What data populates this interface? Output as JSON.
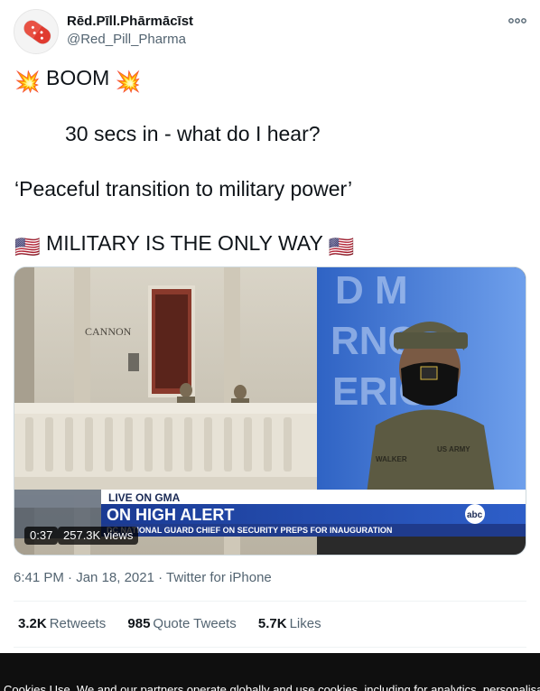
{
  "author": {
    "display_name": "Rēd.Pīll.Phārmācīst",
    "handle": "@Red_Pill_Pharma",
    "avatar_icon": "red-pill-icon"
  },
  "tweet": {
    "line1_text": "BOOM",
    "line1_emoji": "💥",
    "line2_text": "30 secs in - what do I hear?",
    "line3_text": "‘Peaceful transition to military power’",
    "line4_text": "MILITARY IS THE ONLY WAY",
    "line4_emoji": "🇺🇸"
  },
  "video": {
    "duration": "0:37",
    "views": "257.3K views",
    "sign_text": "CANNON",
    "banner_top": "LIVE ON GMA",
    "banner_headline": "ON HIGH ALERT",
    "banner_sub": "DC NATIONAL GUARD CHIEF ON SECURITY PREPS FOR INAUGURATION",
    "network_logo": "abc",
    "name_tape": "WALKER",
    "branch_tape": "US ARMY"
  },
  "meta": {
    "time": "6:41 PM",
    "separator": "·",
    "date": "Jan 18, 2021",
    "source": "Twitter for iPhone"
  },
  "stats": {
    "retweets_count": "3.2K",
    "retweets_label": "Retweets",
    "quotes_count": "985",
    "quotes_label": "Quote Tweets",
    "likes_count": "5.7K",
    "likes_label": "Likes"
  },
  "cookie_banner": {
    "text": "Cookies Use. We and our partners operate globally and use cookies, including for analytics, personalisat"
  },
  "colors": {
    "text_primary": "#0f1419",
    "text_secondary": "#536471",
    "banner_blue": "#1f3b8c",
    "pill_red": "#e03a2f"
  }
}
